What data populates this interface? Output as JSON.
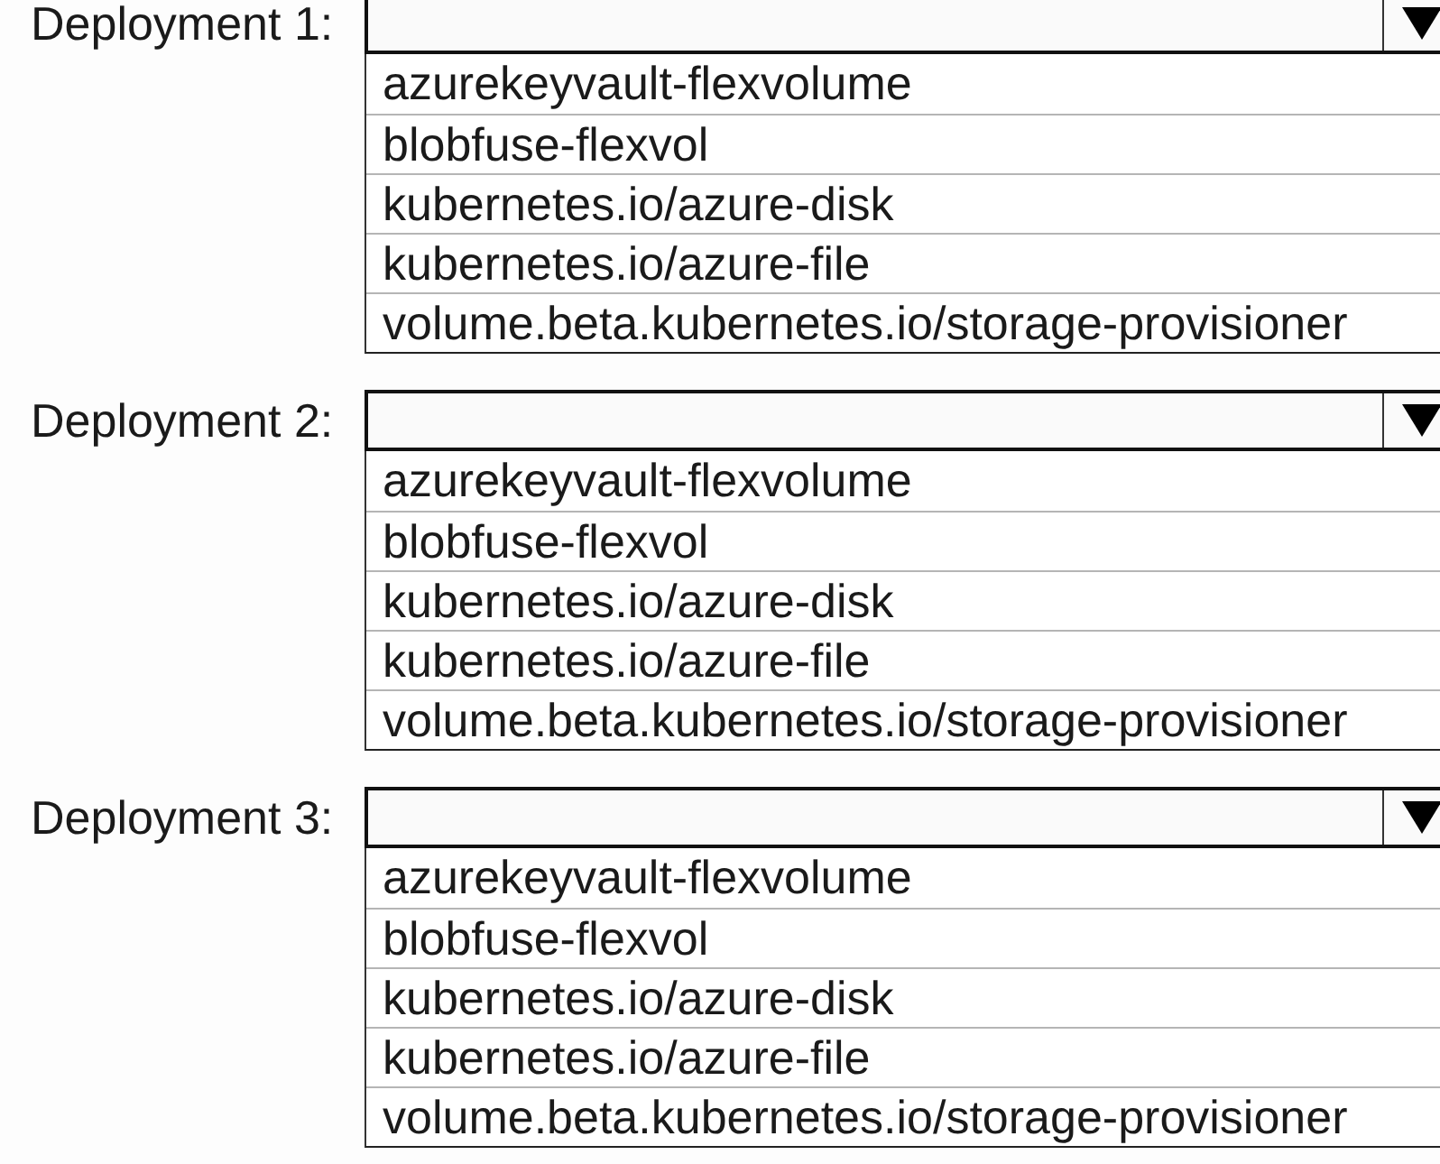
{
  "dropdowns": [
    {
      "label": "Deployment 1:",
      "options": [
        "azurekeyvault-flexvolume",
        "blobfuse-flexvol",
        "kubernetes.io/azure-disk",
        "kubernetes.io/azure-file",
        "volume.beta.kubernetes.io/storage-provisioner"
      ]
    },
    {
      "label": "Deployment 2:",
      "options": [
        "azurekeyvault-flexvolume",
        "blobfuse-flexvol",
        "kubernetes.io/azure-disk",
        "kubernetes.io/azure-file",
        "volume.beta.kubernetes.io/storage-provisioner"
      ]
    },
    {
      "label": "Deployment 3:",
      "options": [
        "azurekeyvault-flexvolume",
        "blobfuse-flexvol",
        "kubernetes.io/azure-disk",
        "kubernetes.io/azure-file",
        "volume.beta.kubernetes.io/storage-provisioner"
      ]
    }
  ]
}
